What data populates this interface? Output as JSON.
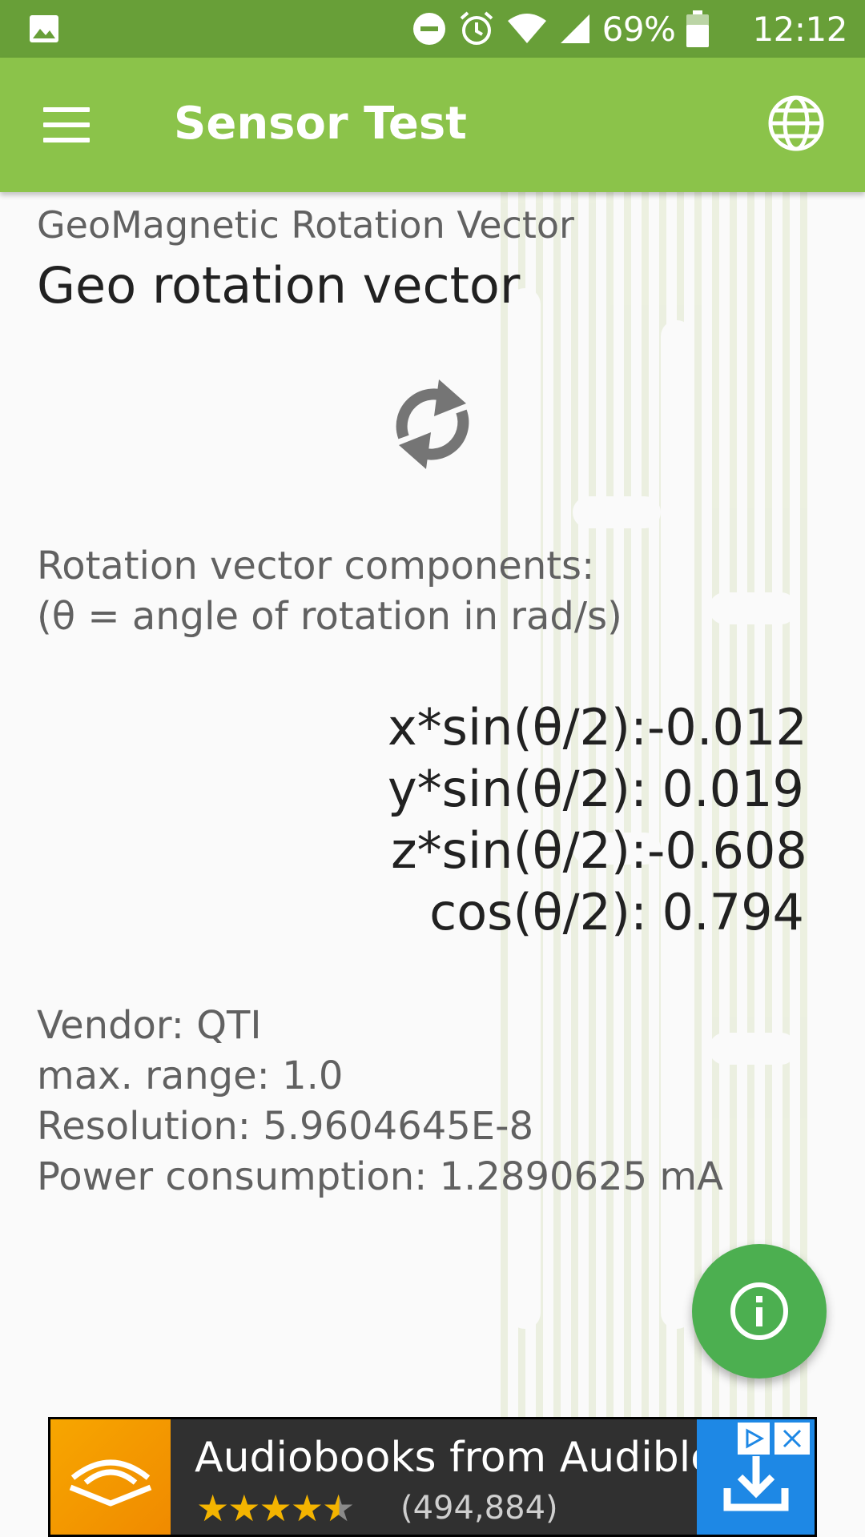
{
  "status_bar": {
    "battery": "69%",
    "time": "12:12",
    "icons": [
      "image-icon",
      "dnd-icon",
      "alarm-icon",
      "wifi-icon",
      "signal-icon",
      "battery-icon"
    ]
  },
  "app_bar": {
    "title": "Sensor Test",
    "icons": [
      "menu-icon",
      "globe-icon"
    ]
  },
  "sensor": {
    "type": "GeoMagnetic Rotation Vector",
    "name": "Geo rotation vector",
    "icon": "rotate-icon"
  },
  "components": {
    "label_line1": "Rotation vector components:",
    "label_line2": "(θ = angle of rotation in rad/s)",
    "rows": [
      {
        "label": "x*sin(θ/2):",
        "value": "-0.012"
      },
      {
        "label": "y*sin(θ/2):",
        "value": "0.019"
      },
      {
        "label": "z*sin(θ/2):",
        "value": "-0.608"
      },
      {
        "label": "cos(θ/2):",
        "value": "0.794"
      }
    ]
  },
  "info": {
    "vendor": "Vendor:  QTI",
    "max_range": "max. range:  1.0",
    "resolution": "Resolution:  5.9604645E-8",
    "power": "Power consumption:  1.2890625 mA"
  },
  "fab": {
    "icon": "info-icon",
    "color": "#4caf50"
  },
  "ad": {
    "title": "Audiobooks from Audible",
    "rating": 4.5,
    "rating_count": "(494,884)",
    "icons": [
      "audible-logo-icon",
      "adchoices-icon",
      "close-icon",
      "download-icon"
    ]
  },
  "colors": {
    "status_bar": "#689f38",
    "app_bar": "#8bc34a",
    "fab": "#4caf50",
    "ad_download": "#1e88e5",
    "ad_logo": "#f7a600"
  }
}
